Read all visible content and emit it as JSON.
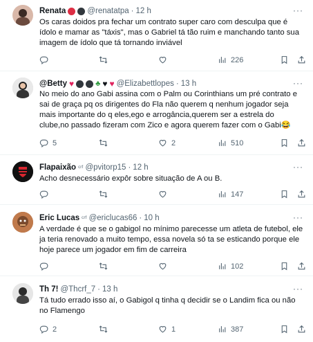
{
  "tweets": [
    {
      "name": "Renata",
      "handle": "@renatatpa",
      "time": "12 h",
      "text": "Os caras doidos pra fechar um contrato super caro com desculpa que é ídolo e mamar as \"táxis\", mas o Gabriel tá tão ruim e manchando tanto sua imagem de ídolo que tá tornando inviável",
      "replies": "",
      "retweets": "",
      "likes": "",
      "views": "226"
    },
    {
      "name": "@Betty",
      "handle": "@Elizabettlopes",
      "time": "13 h",
      "text": "No meio do ano Gabi assina com o Palm ou Corinthians um pré contrato e sai de graça pq os dirigentes do Fla não querem q nenhum jogador seja mais importante do q eles,ego e arrogância,querem ser a estrela do clube,no passado fizeram com Zico e agora querem fazer com o Gabi😂",
      "replies": "5",
      "retweets": "",
      "likes": "2",
      "views": "510"
    },
    {
      "name": "Flapaixão",
      "handle": "@pvitorp15",
      "time": "12 h",
      "text": "Acho desnecessário expôr sobre situação de A ou B.",
      "replies": "",
      "retweets": "",
      "likes": "",
      "views": "147"
    },
    {
      "name": "Eric Lucas",
      "handle": "@ericlucas66",
      "time": "10 h",
      "text": "A verdade é que se o gabigol no mínimo parecesse um atleta de futebol, ele ja teria renovado a muito tempo, essa novela só ta se esticando porque ele hoje parece um jogador em fim de carreira",
      "replies": "",
      "retweets": "",
      "likes": "",
      "views": "102"
    },
    {
      "name": "Th 7!",
      "handle": "@Thcrf_7",
      "time": "13 h",
      "text": "Tá tudo errado isso aí, o Gabigol q tinha q decidir se o Landim fica ou não no Flamengo",
      "replies": "2",
      "retweets": "",
      "likes": "1",
      "views": "387"
    }
  ],
  "ui": {
    "more": "···",
    "sep": "·"
  },
  "flair": {
    "crf": "ᶜʳᶠ"
  },
  "colors": {
    "text": "#0f1419",
    "secondary": "#536471",
    "divider": "#eff3f4",
    "flamengo_red": "#d7262f"
  },
  "icons": [
    "reply-icon",
    "retweet-icon",
    "like-icon",
    "views-icon",
    "bookmark-icon",
    "share-icon",
    "more-icon"
  ]
}
